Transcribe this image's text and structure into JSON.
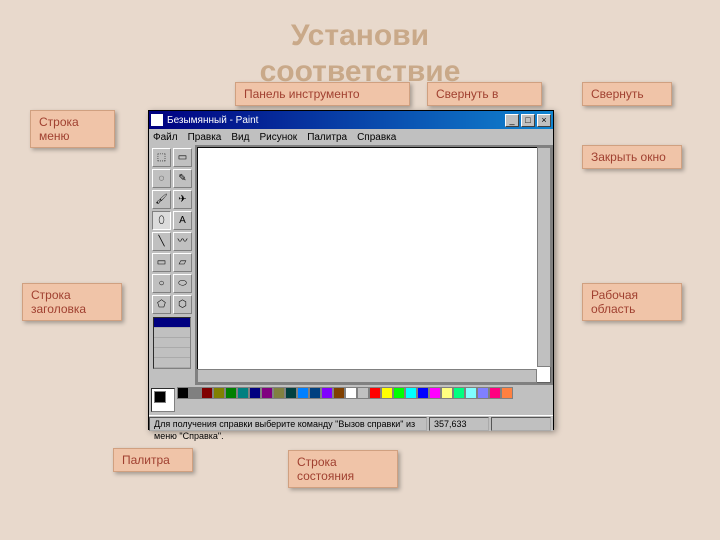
{
  "slide_title": "Установи\nсоответствие",
  "labels": {
    "menu_row": "Строка меню",
    "toolbar": "Панель инструменто",
    "minimize_icon": "Свернуть в",
    "maximize": "Свернуть",
    "close_window": "Закрыть окно",
    "title_row": "Строка заголовка",
    "work_area": "Рабочая область",
    "palette": "Палитра",
    "status_row": "Строка состояния"
  },
  "paint": {
    "title": "Безымянный - Paint",
    "menu": [
      "Файл",
      "Правка",
      "Вид",
      "Рисунок",
      "Палитра",
      "Справка"
    ],
    "winbuttons": {
      "min": "_",
      "max": "□",
      "close": "×"
    },
    "status_hint": "Для получения справки выберите команду \"Вызов справки\" из меню \"Справка\".",
    "coords": "357,633",
    "tools": [
      "⬚",
      "▭",
      "◌",
      "✎",
      "🖌",
      "✈",
      "⬯",
      "A",
      "╲",
      "〰",
      "▭",
      "▱",
      "○",
      "⬭",
      "⬠",
      "⬡"
    ],
    "palette_colors": [
      "#000000",
      "#808080",
      "#800000",
      "#808000",
      "#008000",
      "#008080",
      "#000080",
      "#800080",
      "#808040",
      "#004040",
      "#0080ff",
      "#004080",
      "#8000ff",
      "#804000",
      "#ffffff",
      "#c0c0c0",
      "#ff0000",
      "#ffff00",
      "#00ff00",
      "#00ffff",
      "#0000ff",
      "#ff00ff",
      "#ffff80",
      "#00ff80",
      "#80ffff",
      "#8080ff",
      "#ff0080",
      "#ff8040"
    ]
  }
}
